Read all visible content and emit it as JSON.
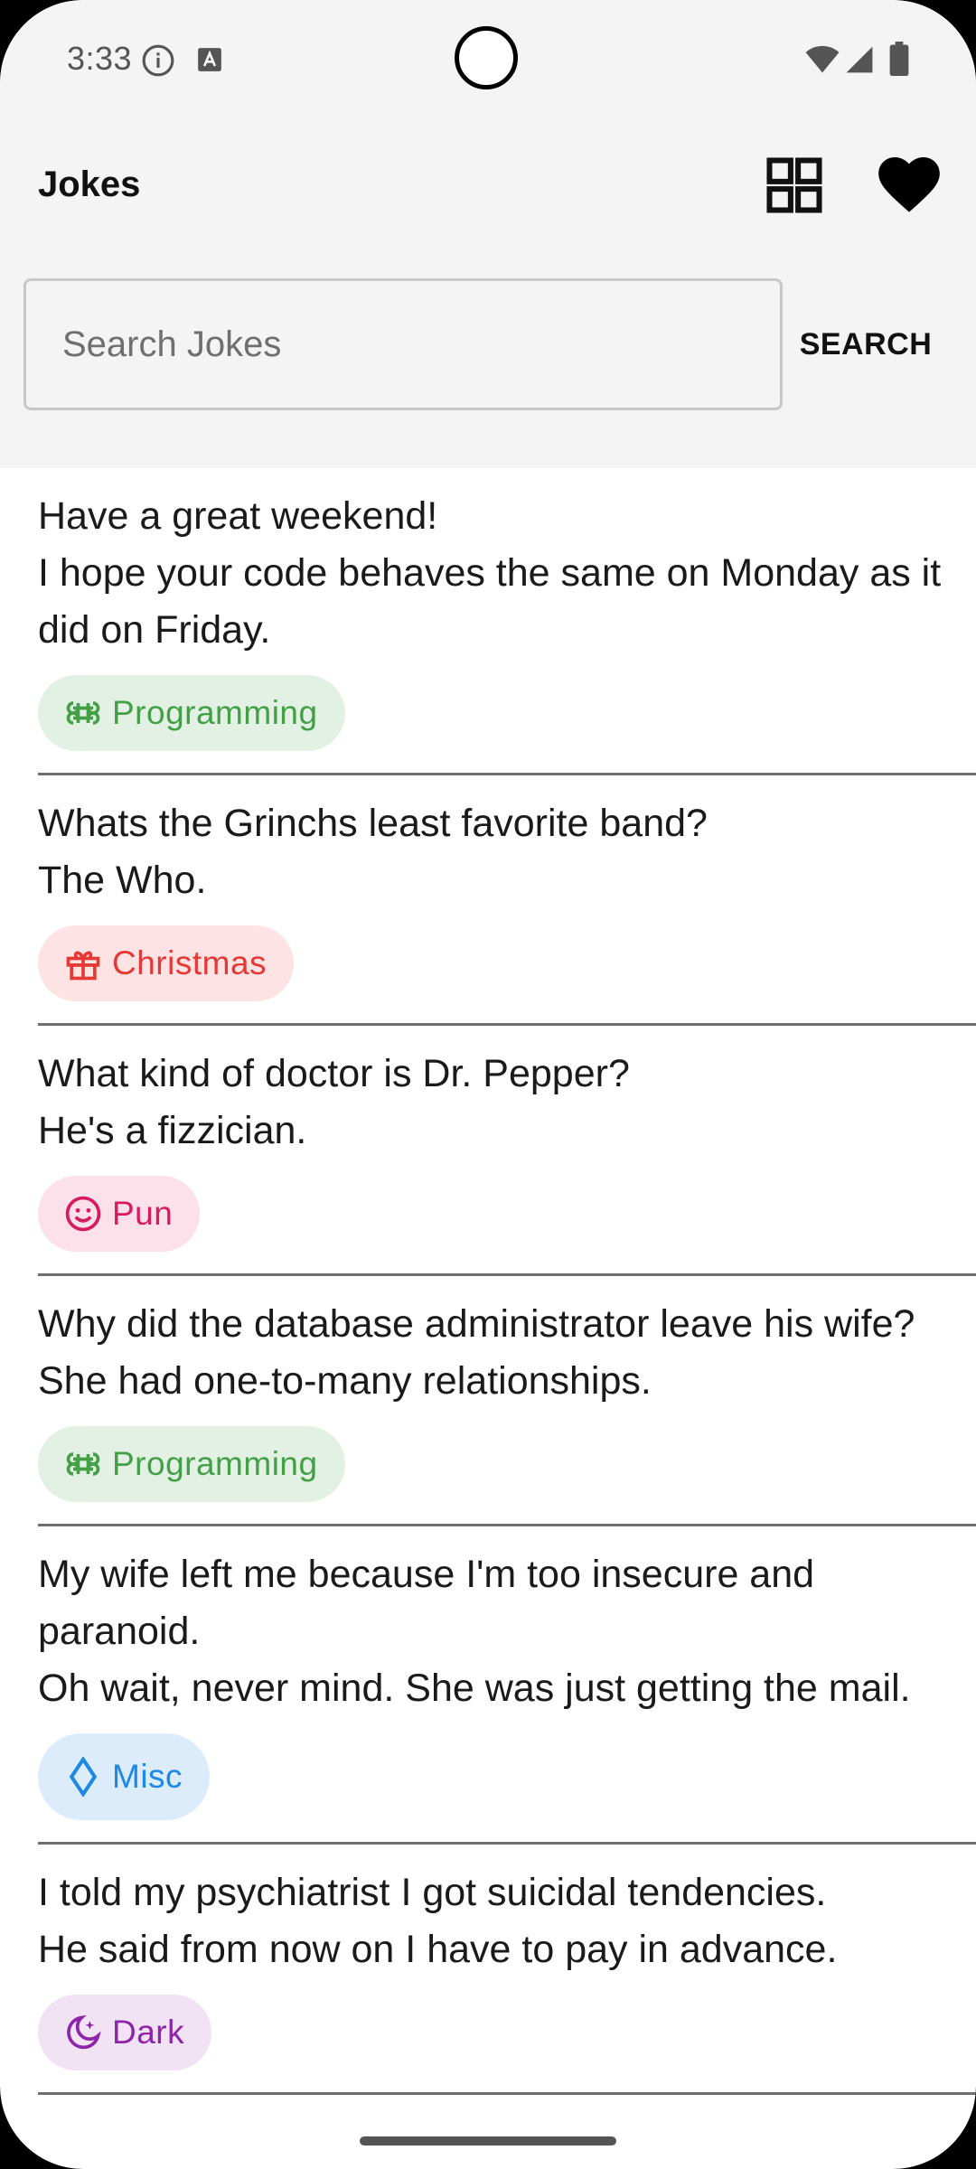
{
  "status_bar": {
    "time": "3:33",
    "icons": [
      "info-icon",
      "a-icon",
      "wifi-icon",
      "signal-icon",
      "battery-icon"
    ]
  },
  "app_bar": {
    "title": "Jokes",
    "actions": [
      "grid-view-icon",
      "heart-icon"
    ]
  },
  "search": {
    "placeholder": "Search Jokes",
    "value": "",
    "button_label": "SEARCH"
  },
  "jokes": [
    {
      "text": "Have a great weekend!\nI hope your code behaves the same on Monday as it did on Friday.",
      "category": "Programming",
      "icon": "command-icon",
      "color": "#43a047"
    },
    {
      "text": "Whats the Grinchs least favorite band?\nThe Who.",
      "category": "Christmas",
      "icon": "gift-icon",
      "color": "#e53935"
    },
    {
      "text": "What kind of doctor is Dr. Pepper?\nHe's a fizzician.",
      "category": "Pun",
      "icon": "smile-icon",
      "color": "#d81b60"
    },
    {
      "text": "Why did the database administrator leave his wife?\nShe had one-to-many relationships.",
      "category": "Programming",
      "icon": "command-icon",
      "color": "#43a047"
    },
    {
      "text": "My wife left me because I'm too insecure and paranoid.\nOh wait, never mind. She was just getting the mail.",
      "category": "Misc",
      "icon": "diamond-icon",
      "color": "#1e88e5"
    },
    {
      "text": "I told my psychiatrist I got suicidal tendencies.\nHe said from now on I have to pay in advance.",
      "category": "Dark",
      "icon": "moon-stars-icon",
      "color": "#8e24aa"
    }
  ]
}
